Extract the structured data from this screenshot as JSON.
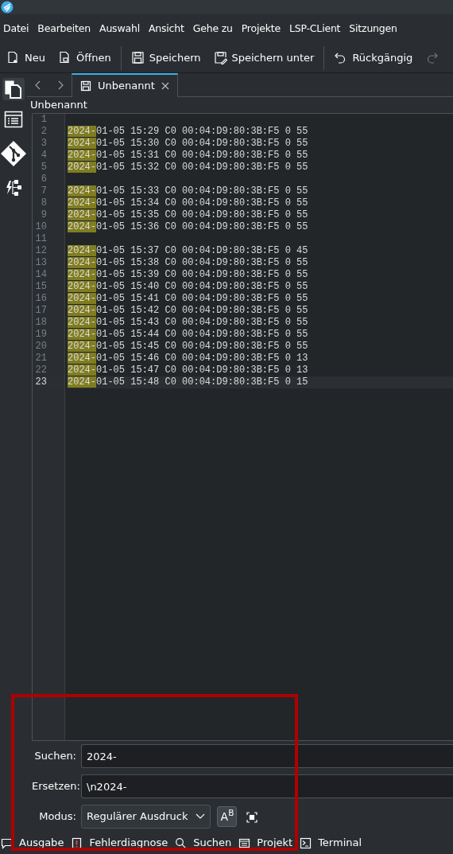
{
  "menu": [
    "Datei",
    "Bearbeiten",
    "Auswahl",
    "Ansicht",
    "Gehe zu",
    "Projekte",
    "LSP-CLient",
    "Sitzungen"
  ],
  "toolbar": [
    {
      "kind": "new",
      "label": "Neu"
    },
    {
      "kind": "open",
      "label": "Öffnen"
    },
    {
      "kind": "sep"
    },
    {
      "kind": "save",
      "label": "Speichern"
    },
    {
      "kind": "saveas",
      "label": "Speichern unter"
    },
    {
      "kind": "sep"
    },
    {
      "kind": "undo",
      "label": "Rückgängig"
    },
    {
      "kind": "redo",
      "disabled": true
    }
  ],
  "sidebar": [
    {
      "kind": "documents",
      "selected": true
    },
    {
      "kind": "outline",
      "selected": false
    },
    {
      "kind": "git",
      "selected": false
    },
    {
      "kind": "lsp",
      "selected": false
    }
  ],
  "tabs": [
    {
      "label": "Unbenannt",
      "selected": true
    }
  ],
  "breadcrumb": "Unbenannt",
  "lines": [
    {
      "number": "1"
    },
    {
      "number": "2",
      "match": "2024-",
      "text": "01-05 15:29 C0 00:04:D9:80:3B:F5 0 55"
    },
    {
      "number": "3",
      "match": "2024-",
      "text": "01-05 15:30 C0 00:04:D9:80:3B:F5 0 55"
    },
    {
      "number": "4",
      "match": "2024-",
      "text": "01-05 15:31 C0 00:04:D9:80:3B:F5 0 55"
    },
    {
      "number": "5",
      "match": "2024-",
      "text": "01-05 15:32 C0 00:04:D9:80:3B:F5 0 55"
    },
    {
      "number": "6"
    },
    {
      "number": "7",
      "match": "2024-",
      "text": "01-05 15:33 C0 00:04:D9:80:3B:F5 0 55"
    },
    {
      "number": "8",
      "match": "2024-",
      "text": "01-05 15:34 C0 00:04:D9:80:3B:F5 0 55"
    },
    {
      "number": "9",
      "match": "2024-",
      "text": "01-05 15:35 C0 00:04:D9:80:3B:F5 0 55"
    },
    {
      "number": "10",
      "match": "2024-",
      "text": "01-05 15:36 C0 00:04:D9:80:3B:F5 0 55"
    },
    {
      "number": "11"
    },
    {
      "number": "12",
      "match": "2024-",
      "text": "01-05 15:37 C0 00:04:D9:80:3B:F5 0 45"
    },
    {
      "number": "13",
      "match": "2024-",
      "text": "01-05 15:38 C0 00:04:D9:80:3B:F5 0 55"
    },
    {
      "number": "14",
      "match": "2024-",
      "text": "01-05 15:39 C0 00:04:D9:80:3B:F5 0 55"
    },
    {
      "number": "15",
      "match": "2024-",
      "text": "01-05 15:40 C0 00:04:D9:80:3B:F5 0 55"
    },
    {
      "number": "16",
      "match": "2024-",
      "text": "01-05 15:41 C0 00:04:D9:80:3B:F5 0 55"
    },
    {
      "number": "17",
      "match": "2024-",
      "text": "01-05 15:42 C0 00:04:D9:80:3B:F5 0 55"
    },
    {
      "number": "18",
      "match": "2024-",
      "text": "01-05 15:43 C0 00:04:D9:80:3B:F5 0 55"
    },
    {
      "number": "19",
      "match": "2024-",
      "text": "01-05 15:44 C0 00:04:D9:80:3B:F5 0 55"
    },
    {
      "number": "20",
      "match": "2024-",
      "text": "01-05 15:45 C0 00:04:D9:80:3B:F5 0 55"
    },
    {
      "number": "21",
      "match": "2024-",
      "text": "01-05 15:46 C0 00:04:D9:80:3B:F5 0 13"
    },
    {
      "number": "22",
      "match": "2024-",
      "text": "01-05 15:47 C0 00:04:D9:80:3B:F5 0 13"
    },
    {
      "number": "23",
      "match": "2024-",
      "text": "01-05 15:48 C0 00:04:D9:80:3B:F5 0 15",
      "current": true
    }
  ],
  "search": {
    "find_label": "Suchen:",
    "find_value": "2024-",
    "replace_label": "Ersetzen:",
    "replace_value": "\\n2024-",
    "mode_label": "Modus:",
    "mode_value": "Regulärer Ausdruck",
    "match_case": {
      "label": "A",
      "sup": "B"
    }
  },
  "bottom_tabs": [
    {
      "kind": "output",
      "label": "Ausgabe"
    },
    {
      "kind": "diagnostics",
      "label": "Fehlerdiagnose"
    },
    {
      "kind": "search",
      "label": "Suchen"
    },
    {
      "kind": "project",
      "label": "Projekt"
    },
    {
      "kind": "terminal",
      "label": "Terminal"
    }
  ],
  "annotation": {
    "kind": "frame",
    "color": "#b00000"
  }
}
